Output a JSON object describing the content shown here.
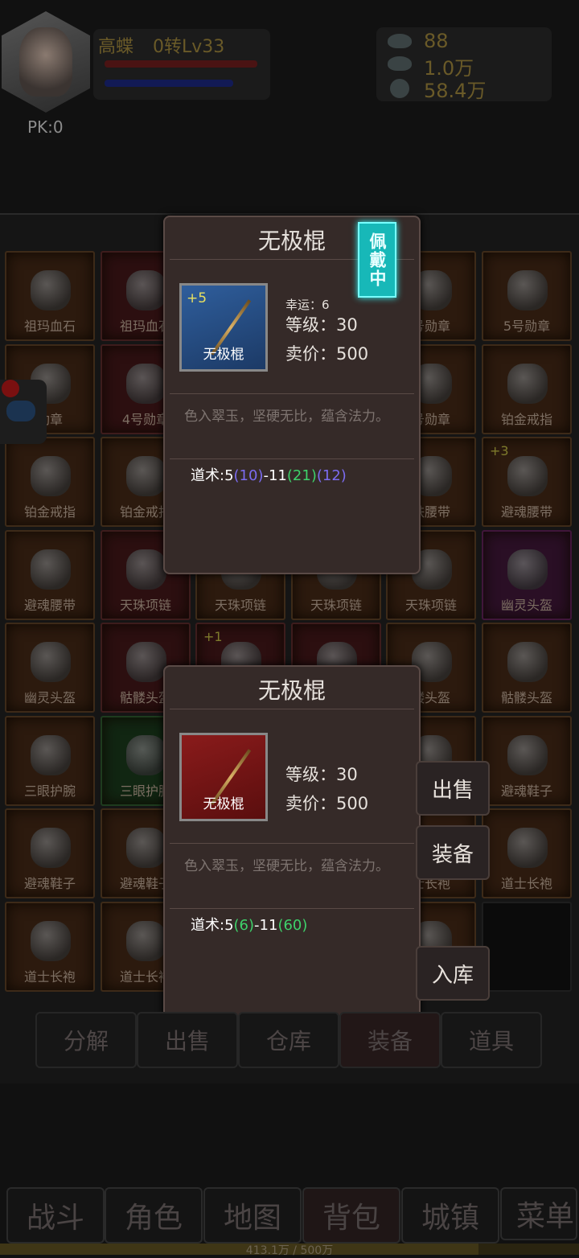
{
  "player": {
    "name": "高蝶",
    "level": "0转Lv33",
    "pk": "PK:0"
  },
  "currency": [
    {
      "icon": "ingot-icon",
      "value": "88"
    },
    {
      "icon": "ingot-icon",
      "value": "1.0万"
    },
    {
      "icon": "coin-icon",
      "value": "58.4万"
    }
  ],
  "grid": {
    "rows": [
      [
        {
          "name": "祖玛血石",
          "bg": "orange"
        },
        {
          "name": "祖玛血石",
          "bg": "red"
        },
        {
          "name": "",
          "bg": "orange"
        },
        {
          "name": "",
          "bg": "orange"
        },
        {
          "name": "号勋章",
          "bg": "orange"
        },
        {
          "name": "5号勋章",
          "bg": "orange"
        }
      ],
      [
        {
          "name": "勋章",
          "bg": "orange"
        },
        {
          "name": "4号勋章",
          "bg": "red"
        },
        {
          "name": "",
          "bg": "orange"
        },
        {
          "name": "",
          "bg": "orange"
        },
        {
          "name": "号勋章",
          "bg": "orange"
        },
        {
          "name": "铂金戒指",
          "bg": "orange"
        }
      ],
      [
        {
          "name": "铂金戒指",
          "bg": "orange"
        },
        {
          "name": "铂金戒指",
          "bg": "orange"
        },
        {
          "name": "",
          "bg": "orange"
        },
        {
          "name": "",
          "bg": "orange"
        },
        {
          "name": "铁腰带",
          "bg": "orange"
        },
        {
          "name": "避魂腰带",
          "bg": "orange",
          "plus": "+3"
        }
      ],
      [
        {
          "name": "避魂腰带",
          "bg": "orange"
        },
        {
          "name": "天珠项链",
          "bg": "red"
        },
        {
          "name": "天珠项链",
          "bg": "orange"
        },
        {
          "name": "天珠项链",
          "bg": "orange"
        },
        {
          "name": "天珠项链",
          "bg": "orange"
        },
        {
          "name": "幽灵头盔",
          "bg": "purple"
        }
      ],
      [
        {
          "name": "幽灵头盔",
          "bg": "orange"
        },
        {
          "name": "骷髅头盔",
          "bg": "red"
        },
        {
          "name": "",
          "bg": "red",
          "plus": "+1"
        },
        {
          "name": "",
          "bg": "red"
        },
        {
          "name": "髅头盔",
          "bg": "orange"
        },
        {
          "name": "骷髅头盔",
          "bg": "orange"
        }
      ],
      [
        {
          "name": "三眼护腕",
          "bg": "orange"
        },
        {
          "name": "三眼护腕",
          "bg": "green"
        },
        {
          "name": "",
          "bg": "orange"
        },
        {
          "name": "",
          "bg": "orange"
        },
        {
          "name": "",
          "bg": "orange"
        },
        {
          "name": "避魂鞋子",
          "bg": "orange"
        }
      ],
      [
        {
          "name": "避魂鞋子",
          "bg": "orange"
        },
        {
          "name": "避魂鞋子",
          "bg": "orange"
        },
        {
          "name": "",
          "bg": "orange"
        },
        {
          "name": "",
          "bg": "orange"
        },
        {
          "name": "士长袍",
          "bg": "orange"
        },
        {
          "name": "道士长袍",
          "bg": "orange"
        }
      ],
      [
        {
          "name": "道士长袍",
          "bg": "orange"
        },
        {
          "name": "道士长袍",
          "bg": "orange"
        },
        {
          "name": "",
          "bg": "orange"
        },
        {
          "name": "",
          "bg": "orange"
        },
        {
          "name": "",
          "bg": "orange"
        },
        {
          "name": "",
          "bg": "empty"
        }
      ]
    ]
  },
  "tooltip_equipped": {
    "title": "无极棍",
    "badge": "佩戴中",
    "icon_label": "无极棍",
    "icon_plus": "+5",
    "luck": "幸运：6",
    "level": "等级：30",
    "price": "卖价：500",
    "desc": "色入翠玉，坚硬无比，蕴含法力。",
    "attr": {
      "prefix": "道术:5",
      "a1": "(10)",
      "mid": "-11",
      "a2": "(21)",
      "a3": "(12)"
    }
  },
  "tooltip_bag": {
    "title": "无极棍",
    "icon_label": "无极棍",
    "level": "等级：30",
    "price": "卖价：500",
    "desc": "色入翠玉，坚硬无比，蕴含法力。",
    "attr": {
      "prefix": "道术:5",
      "a1": "(6)",
      "mid": "-11",
      "a2": "(60)"
    }
  },
  "actions": {
    "sell": "出售",
    "equip": "装备",
    "store": "入库"
  },
  "tabs": [
    "分解",
    "出售",
    "仓库",
    "装备",
    "道具"
  ],
  "nav": [
    "战斗",
    "角色",
    "地图",
    "背包",
    "城镇",
    "菜单"
  ],
  "xp": {
    "text": "413.1万 / 500万",
    "fraction": 0.826
  }
}
